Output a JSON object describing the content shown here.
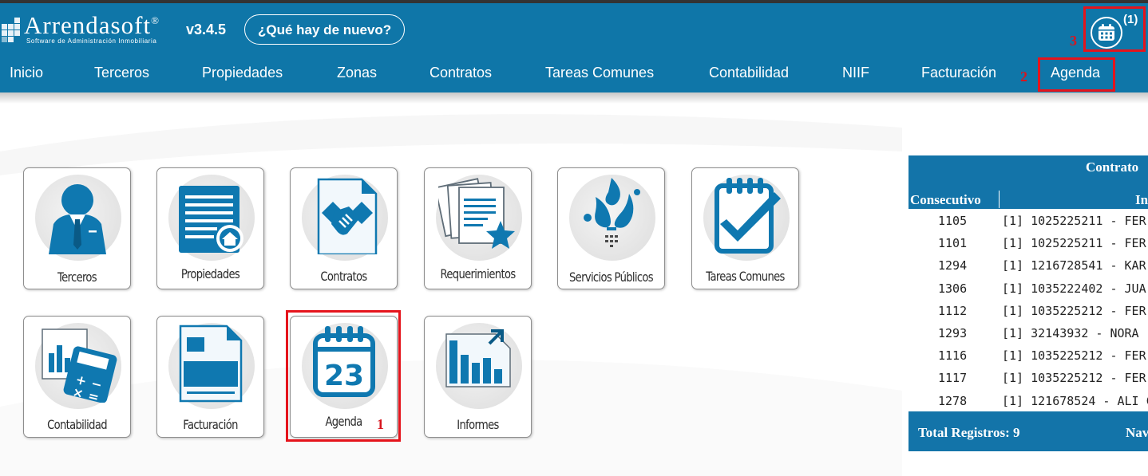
{
  "app": {
    "name": "Arrendasoft",
    "trademark": "®",
    "subtitle": "Software de Administración Inmobiliaria",
    "version": "v3.4.5",
    "whats_new_label": "¿Qué hay de nuevo?",
    "calendar_count": "(1)"
  },
  "colors": {
    "header": "#0f76a8",
    "annotation_red": "#e5141c",
    "icon_blue": "#0f78b0",
    "panel": "#1374a9"
  },
  "nav": {
    "items": [
      {
        "label": "Inicio"
      },
      {
        "label": "Terceros"
      },
      {
        "label": "Propiedades"
      },
      {
        "label": "Zonas"
      },
      {
        "label": "Contratos"
      },
      {
        "label": "Tareas Comunes"
      },
      {
        "label": "Contabilidad"
      },
      {
        "label": "NIIF"
      },
      {
        "label": "Facturación"
      },
      {
        "label": "Agenda"
      }
    ]
  },
  "annotations": {
    "one": "1",
    "two": "2",
    "three": "3"
  },
  "modules": [
    {
      "label": "Terceros",
      "icon": "user-icon"
    },
    {
      "label": "Propiedades",
      "icon": "property-list-icon"
    },
    {
      "label": "Contratos",
      "icon": "handshake-icon"
    },
    {
      "label": "Requerimientos",
      "icon": "documents-star-icon"
    },
    {
      "label": "Servicios Públicos",
      "icon": "water-splash-icon"
    },
    {
      "label": "Tareas Comunes",
      "icon": "checklist-icon"
    },
    {
      "label": "Contabilidad",
      "icon": "calculator-icon"
    },
    {
      "label": "Facturación",
      "icon": "invoice-icon"
    },
    {
      "label": "Agenda",
      "icon": "calendar-icon",
      "day": "23"
    },
    {
      "label": "Informes",
      "icon": "bar-chart-icon"
    }
  ],
  "contracts_panel": {
    "title": "Contrato",
    "columns": [
      "Consecutivo",
      "In"
    ],
    "rows": [
      {
        "consecutivo": "1105",
        "inquilino": "[1] 1025225211 - FER"
      },
      {
        "consecutivo": "1101",
        "inquilino": "[1] 1025225211 - FER"
      },
      {
        "consecutivo": "1294",
        "inquilino": "[1] 1216728541 - KAR"
      },
      {
        "consecutivo": "1306",
        "inquilino": "[1] 1035222402 - JUA"
      },
      {
        "consecutivo": "1112",
        "inquilino": "[1] 1035225212 - FER"
      },
      {
        "consecutivo": "1293",
        "inquilino": "[1] 32143932 - NORA"
      },
      {
        "consecutivo": "1116",
        "inquilino": "[1] 1035225212 - FER"
      },
      {
        "consecutivo": "1117",
        "inquilino": "[1] 1035225212 - FER"
      },
      {
        "consecutivo": "1278",
        "inquilino": "[1] 121678524 - ALI C"
      }
    ],
    "total_label": "Total Registros: 9",
    "nav_label": "Nav"
  }
}
